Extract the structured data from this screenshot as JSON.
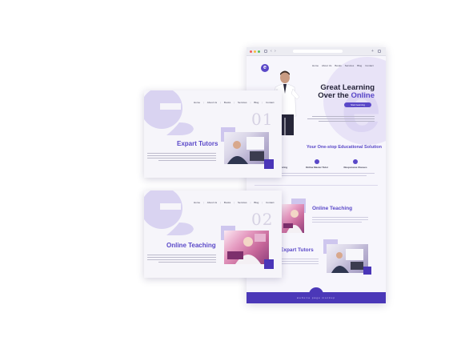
{
  "browser": {
    "url": "",
    "nav": [
      "Home",
      "About Us",
      "Books",
      "Services",
      "Blog",
      "Contact"
    ],
    "hero": {
      "title_line1": "Great Learning",
      "title_line2_prefix": "Over the ",
      "title_line2_accent": "Online",
      "button": "Start learning"
    },
    "section_title": "Your One-stop Educational Solution",
    "features": [
      "Online Tutoring",
      "Online Master Tutor",
      "Responsive Classes"
    ],
    "online_teaching_title": "Online Teaching",
    "expart_tutors_title": "Expart Tutors",
    "footer_text": "website page mockup"
  },
  "card1": {
    "nav": [
      "Home",
      "About Us",
      "Books",
      "Services",
      "Blog",
      "Contact"
    ],
    "number": "01",
    "title": "Expart Tutors"
  },
  "card2": {
    "nav": [
      "Home",
      "About Us",
      "Books",
      "Services",
      "Blog",
      "Contact"
    ],
    "number": "02",
    "title": "Online Teaching"
  },
  "colors": {
    "accent": "#5a48c8",
    "footer": "#4b38b8",
    "lavender": "#cec6ee"
  },
  "icons": [
    "e-logo-icon",
    "bulb-icon",
    "tutor-icon",
    "class-icon",
    "share-icon"
  ]
}
